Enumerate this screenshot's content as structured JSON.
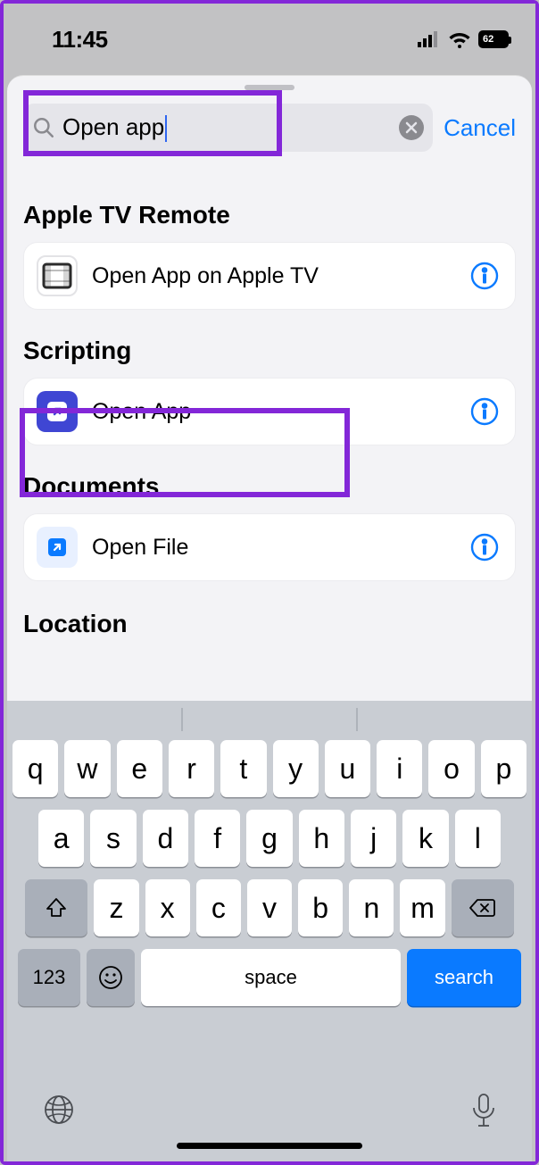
{
  "statusbar": {
    "time": "11:45",
    "battery": "62"
  },
  "search": {
    "value": "Open app",
    "cancel": "Cancel"
  },
  "sections": [
    {
      "header": "Apple TV Remote",
      "items": [
        {
          "label": "Open App on Apple TV",
          "iconName": "appletv-icon"
        }
      ]
    },
    {
      "header": "Scripting",
      "items": [
        {
          "label": "Open App",
          "iconName": "open-app-icon"
        }
      ]
    },
    {
      "header": "Documents",
      "items": [
        {
          "label": "Open File",
          "iconName": "open-file-icon"
        }
      ]
    },
    {
      "header": "Location",
      "items": []
    }
  ],
  "keyboard": {
    "row1": [
      "q",
      "w",
      "e",
      "r",
      "t",
      "y",
      "u",
      "i",
      "o",
      "p"
    ],
    "row2": [
      "a",
      "s",
      "d",
      "f",
      "g",
      "h",
      "j",
      "k",
      "l"
    ],
    "row3": [
      "z",
      "x",
      "c",
      "v",
      "b",
      "n",
      "m"
    ],
    "numKey": "123",
    "space": "space",
    "search": "search"
  }
}
